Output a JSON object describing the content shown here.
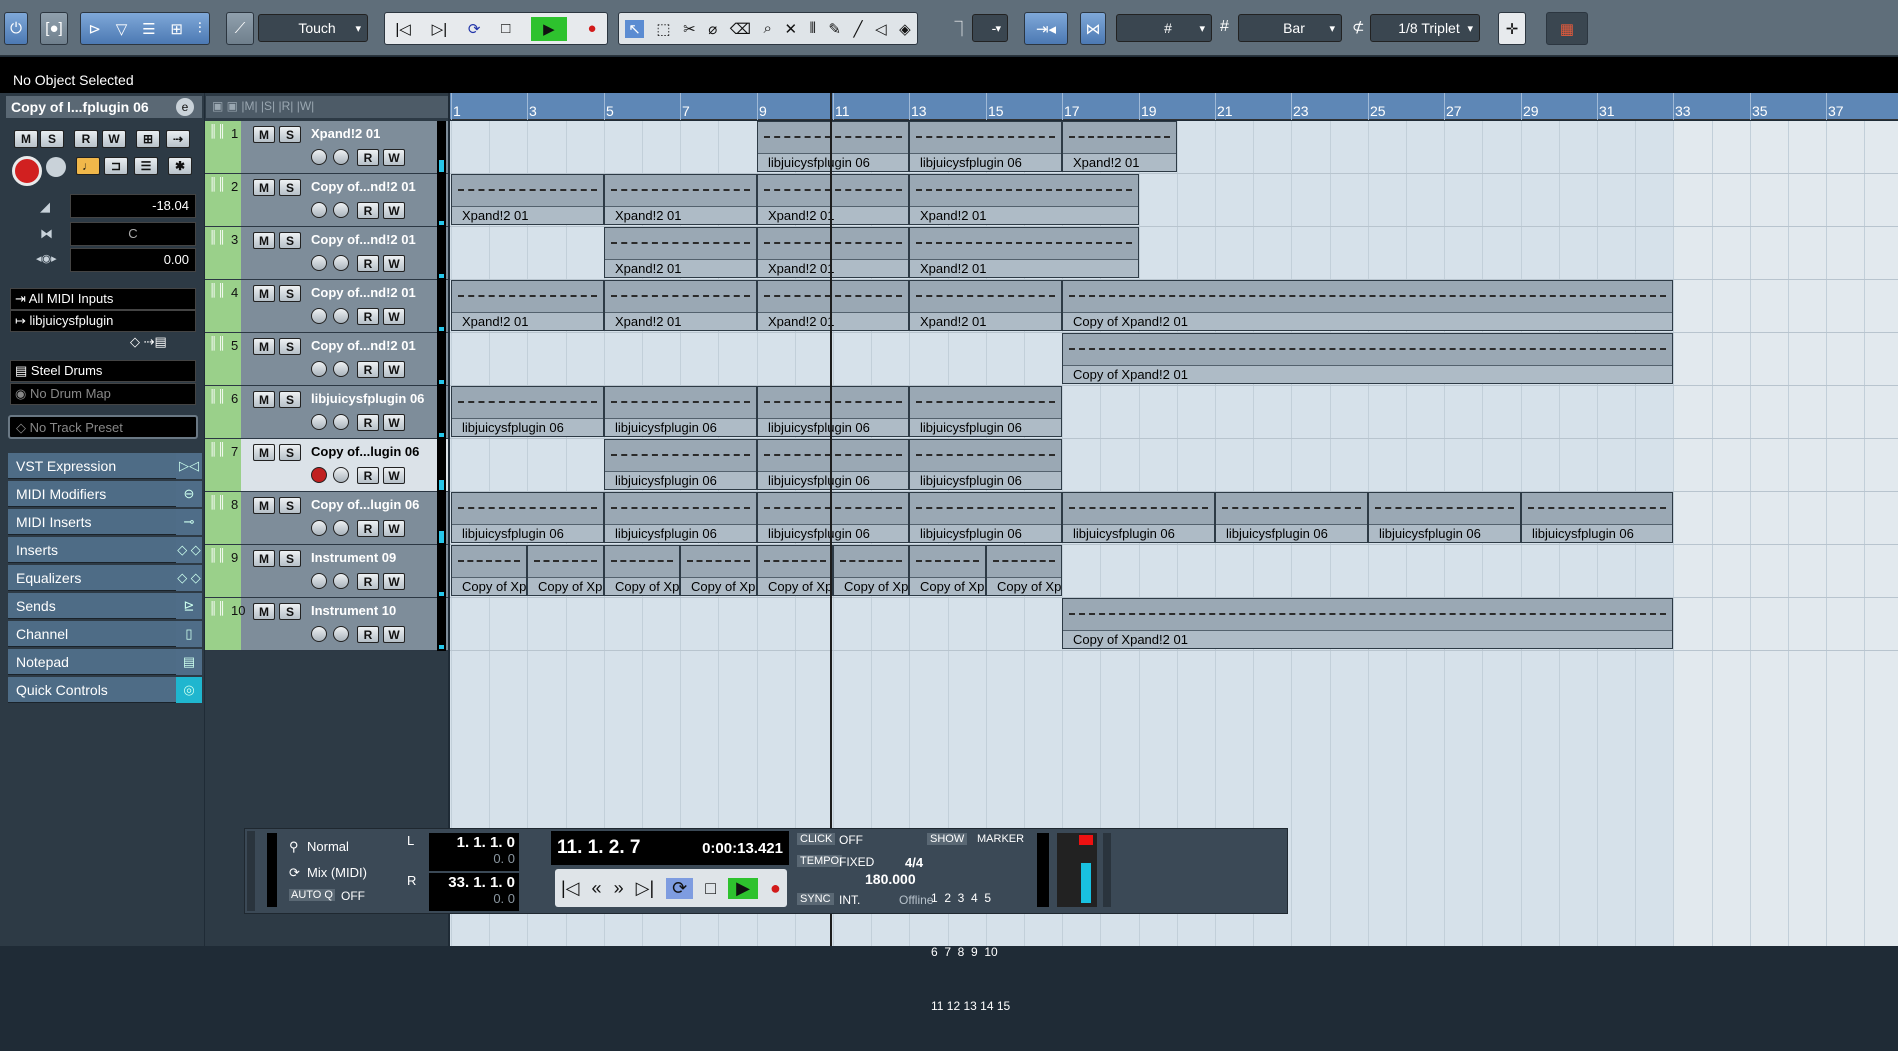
{
  "toolbar": {
    "automation_mode": "Touch",
    "quantize_grid": "Bar",
    "quantize_value": "1/8 Triplet",
    "snap_value": "-"
  },
  "info_line": "No Object Selected",
  "inspector": {
    "track_name": "Copy of l...fplugin 06",
    "volume": "-18.04",
    "pan": "C",
    "delay": "0.00",
    "midi_input": "All MIDI Inputs",
    "midi_output": "libjuicysfplugin",
    "program": "Steel Drums",
    "drum_map": "No Drum Map",
    "track_preset": "No Track Preset",
    "sections": [
      {
        "label": "VST Expression"
      },
      {
        "label": "MIDI Modifiers"
      },
      {
        "label": "MIDI Inserts"
      },
      {
        "label": "Inserts"
      },
      {
        "label": "Equalizers"
      },
      {
        "label": "Sends"
      },
      {
        "label": "Channel"
      },
      {
        "label": "Notepad"
      },
      {
        "label": "Quick Controls"
      }
    ]
  },
  "tracks": [
    {
      "num": "1",
      "name": "Xpand!2 01",
      "rec": false
    },
    {
      "num": "2",
      "name": "Copy of...nd!2 01",
      "rec": false
    },
    {
      "num": "3",
      "name": "Copy of...nd!2 01",
      "rec": false
    },
    {
      "num": "4",
      "name": "Copy of...nd!2 01",
      "rec": false
    },
    {
      "num": "5",
      "name": "Copy of...nd!2 01",
      "rec": false
    },
    {
      "num": "6",
      "name": "libjuicysfplugin 06",
      "rec": false
    },
    {
      "num": "7",
      "name": "Copy of...lugin 06",
      "rec": true
    },
    {
      "num": "8",
      "name": "Copy of...lugin 06",
      "rec": false
    },
    {
      "num": "9",
      "name": "Instrument 09",
      "rec": false
    },
    {
      "num": "10",
      "name": "Instrument 10",
      "rec": false
    }
  ],
  "ruler": {
    "labels": [
      "1",
      "3",
      "5",
      "7",
      "9",
      "11",
      "13",
      "15",
      "17",
      "19",
      "21",
      "23",
      "25",
      "27",
      "29",
      "31",
      "33",
      "35",
      "37"
    ]
  },
  "parts": [
    {
      "track": 1,
      "bar_start": 9,
      "bar_end": 13,
      "label": "libjuicysfplugin 06"
    },
    {
      "track": 1,
      "bar_start": 13,
      "bar_end": 17,
      "label": "libjuicysfplugin 06"
    },
    {
      "track": 1,
      "bar_start": 17,
      "bar_end": 20,
      "label": "Xpand!2 01"
    },
    {
      "track": 2,
      "bar_start": 1,
      "bar_end": 5,
      "label": "Xpand!2 01"
    },
    {
      "track": 2,
      "bar_start": 5,
      "bar_end": 9,
      "label": "Xpand!2 01"
    },
    {
      "track": 2,
      "bar_start": 9,
      "bar_end": 13,
      "label": "Xpand!2 01"
    },
    {
      "track": 2,
      "bar_start": 13,
      "bar_end": 19,
      "label": "Xpand!2 01"
    },
    {
      "track": 3,
      "bar_start": 5,
      "bar_end": 9,
      "label": "Xpand!2 01"
    },
    {
      "track": 3,
      "bar_start": 9,
      "bar_end": 13,
      "label": "Xpand!2 01"
    },
    {
      "track": 3,
      "bar_start": 13,
      "bar_end": 19,
      "label": "Xpand!2 01"
    },
    {
      "track": 4,
      "bar_start": 1,
      "bar_end": 5,
      "label": "Xpand!2 01"
    },
    {
      "track": 4,
      "bar_start": 5,
      "bar_end": 9,
      "label": "Xpand!2 01"
    },
    {
      "track": 4,
      "bar_start": 9,
      "bar_end": 13,
      "label": "Xpand!2 01"
    },
    {
      "track": 4,
      "bar_start": 13,
      "bar_end": 17,
      "label": "Xpand!2 01"
    },
    {
      "track": 4,
      "bar_start": 17,
      "bar_end": 33,
      "label": "Copy of Xpand!2 01"
    },
    {
      "track": 5,
      "bar_start": 17,
      "bar_end": 33,
      "label": "Copy of Xpand!2 01"
    },
    {
      "track": 6,
      "bar_start": 1,
      "bar_end": 5,
      "label": "libjuicysfplugin 06"
    },
    {
      "track": 6,
      "bar_start": 5,
      "bar_end": 9,
      "label": "libjuicysfplugin 06"
    },
    {
      "track": 6,
      "bar_start": 9,
      "bar_end": 13,
      "label": "libjuicysfplugin 06"
    },
    {
      "track": 6,
      "bar_start": 13,
      "bar_end": 17,
      "label": "libjuicysfplugin 06"
    },
    {
      "track": 7,
      "bar_start": 5,
      "bar_end": 9,
      "label": "libjuicysfplugin 06"
    },
    {
      "track": 7,
      "bar_start": 9,
      "bar_end": 13,
      "label": "libjuicysfplugin 06"
    },
    {
      "track": 7,
      "bar_start": 13,
      "bar_end": 17,
      "label": "libjuicysfplugin 06"
    },
    {
      "track": 8,
      "bar_start": 1,
      "bar_end": 5,
      "label": "libjuicysfplugin 06"
    },
    {
      "track": 8,
      "bar_start": 5,
      "bar_end": 9,
      "label": "libjuicysfplugin 06"
    },
    {
      "track": 8,
      "bar_start": 9,
      "bar_end": 13,
      "label": "libjuicysfplugin 06"
    },
    {
      "track": 8,
      "bar_start": 13,
      "bar_end": 17,
      "label": "libjuicysfplugin 06"
    },
    {
      "track": 8,
      "bar_start": 17,
      "bar_end": 21,
      "label": "libjuicysfplugin 06"
    },
    {
      "track": 8,
      "bar_start": 21,
      "bar_end": 25,
      "label": "libjuicysfplugin 06"
    },
    {
      "track": 8,
      "bar_start": 25,
      "bar_end": 29,
      "label": "libjuicysfplugin 06"
    },
    {
      "track": 8,
      "bar_start": 29,
      "bar_end": 33,
      "label": "libjuicysfplugin 06"
    },
    {
      "track": 9,
      "bar_start": 1,
      "bar_end": 3,
      "label": "Copy of Xp"
    },
    {
      "track": 9,
      "bar_start": 3,
      "bar_end": 5,
      "label": "Copy of Xp"
    },
    {
      "track": 9,
      "bar_start": 5,
      "bar_end": 7,
      "label": "Copy of Xp"
    },
    {
      "track": 9,
      "bar_start": 7,
      "bar_end": 9,
      "label": "Copy of Xp"
    },
    {
      "track": 9,
      "bar_start": 9,
      "bar_end": 11,
      "label": "Copy of Xp"
    },
    {
      "track": 9,
      "bar_start": 11,
      "bar_end": 13,
      "label": "Copy of Xp"
    },
    {
      "track": 9,
      "bar_start": 13,
      "bar_end": 15,
      "label": "Copy of Xp"
    },
    {
      "track": 9,
      "bar_start": 15,
      "bar_end": 17,
      "label": "Copy of Xp"
    },
    {
      "track": 10,
      "bar_start": 17,
      "bar_end": 33,
      "label": "Copy of Xpand!2 01"
    }
  ],
  "transport": {
    "record_mode": "Normal",
    "cycle_record_mode": "Mix (MIDI)",
    "autoq_label": "AUTO Q",
    "autoq_value": "OFF",
    "left_locator": "1. 1. 1.   0",
    "left_locator_sub": "0.   0",
    "right_locator": "33. 1. 1.   0",
    "right_locator_sub": "0.   0",
    "position_bars": "11. 1. 2.   7",
    "position_time": "0:00:13.421",
    "click_label": "CLICK",
    "click_value": "OFF",
    "tempo_label": "TEMPO",
    "tempo_mode": "FIXED",
    "signature": "4/4",
    "tempo_value": "180.000",
    "sync_label": "SYNC",
    "sync_mode": "INT.",
    "sync_status": "Offline",
    "show_label": "SHOW",
    "marker_label": "MARKER",
    "marker_rows": [
      "1  2  3  4  5",
      "6  7  8  9  10",
      "11 12 13 14 15"
    ]
  }
}
